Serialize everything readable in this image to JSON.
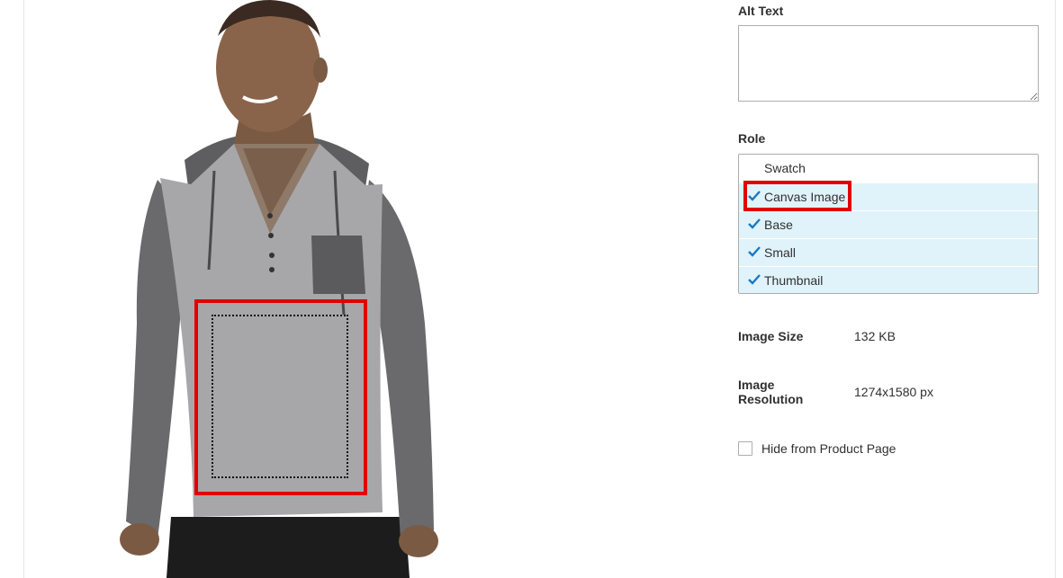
{
  "form": {
    "alt_text_label": "Alt Text",
    "alt_text_value": "",
    "role_label": "Role",
    "roles": [
      {
        "label": "Swatch",
        "selected": false
      },
      {
        "label": "Canvas Image",
        "selected": true
      },
      {
        "label": "Base",
        "selected": true
      },
      {
        "label": "Small",
        "selected": true
      },
      {
        "label": "Thumbnail",
        "selected": true
      }
    ],
    "image_size_label": "Image Size",
    "image_size_value": "132 KB",
    "image_resolution_label": "Image Resolution",
    "image_resolution_value": "1274x1580 px",
    "hide_label": "Hide from Product Page",
    "hide_checked": false
  },
  "icons": {
    "check": "checkmark-icon",
    "product": "hoodie-product-image"
  },
  "colors": {
    "highlight": "#e00000",
    "selected_bg": "#e0f3fb",
    "check": "#1979c3"
  }
}
